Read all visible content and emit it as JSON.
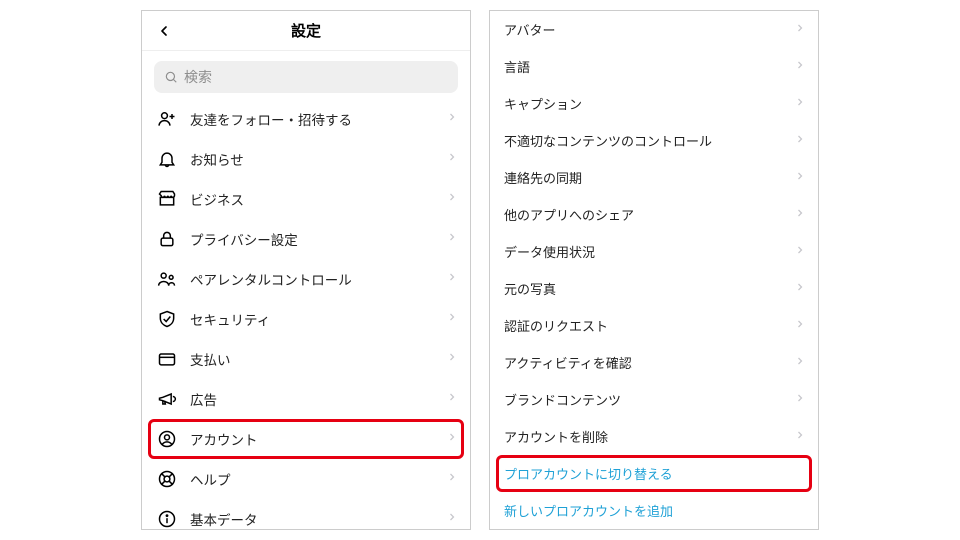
{
  "left": {
    "title": "設定",
    "search_placeholder": "検索",
    "items": [
      {
        "label": "友達をフォロー・招待する"
      },
      {
        "label": "お知らせ"
      },
      {
        "label": "ビジネス"
      },
      {
        "label": "プライバシー設定"
      },
      {
        "label": "ペアレンタルコントロール"
      },
      {
        "label": "セキュリティ"
      },
      {
        "label": "支払い"
      },
      {
        "label": "広告"
      },
      {
        "label": "アカウント"
      },
      {
        "label": "ヘルプ"
      },
      {
        "label": "基本データ"
      }
    ]
  },
  "right": {
    "items": [
      {
        "label": "アバター"
      },
      {
        "label": "言語"
      },
      {
        "label": "キャプション"
      },
      {
        "label": "不適切なコンテンツのコントロール"
      },
      {
        "label": "連絡先の同期"
      },
      {
        "label": "他のアプリへのシェア"
      },
      {
        "label": "データ使用状況"
      },
      {
        "label": "元の写真"
      },
      {
        "label": "認証のリクエスト"
      },
      {
        "label": "アクティビティを確認"
      },
      {
        "label": "ブランドコンテンツ"
      },
      {
        "label": "アカウントを削除"
      },
      {
        "label": "プロアカウントに切り替える"
      },
      {
        "label": "新しいプロアカウントを追加"
      }
    ]
  }
}
